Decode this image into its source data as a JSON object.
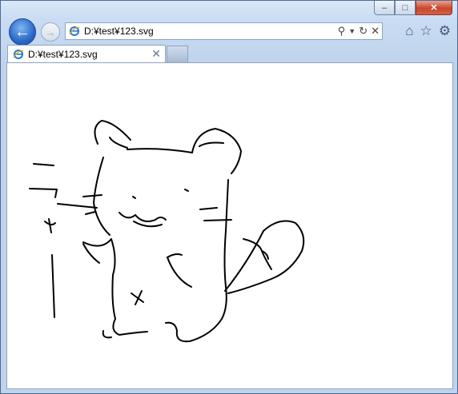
{
  "window": {
    "minimize_icon": "minimize-icon",
    "maximize_icon": "maximize-icon",
    "close_icon": "close-icon"
  },
  "toolbar": {
    "back_icon": "back-arrow-icon",
    "forward_icon": "forward-arrow-icon",
    "address": "D:¥test¥123.svg",
    "search_icon": "search-icon",
    "refresh_icon": "refresh-icon",
    "stop_icon": "stop-icon",
    "home_icon": "home-icon",
    "favorites_icon": "star-icon",
    "tools_icon": "gear-icon"
  },
  "tabs": [
    {
      "label": "D:¥test¥123.svg",
      "active": true
    }
  ],
  "colors": {
    "chrome": "#c3d7ef",
    "close": "#c7462c",
    "back": "#2a69c9"
  }
}
